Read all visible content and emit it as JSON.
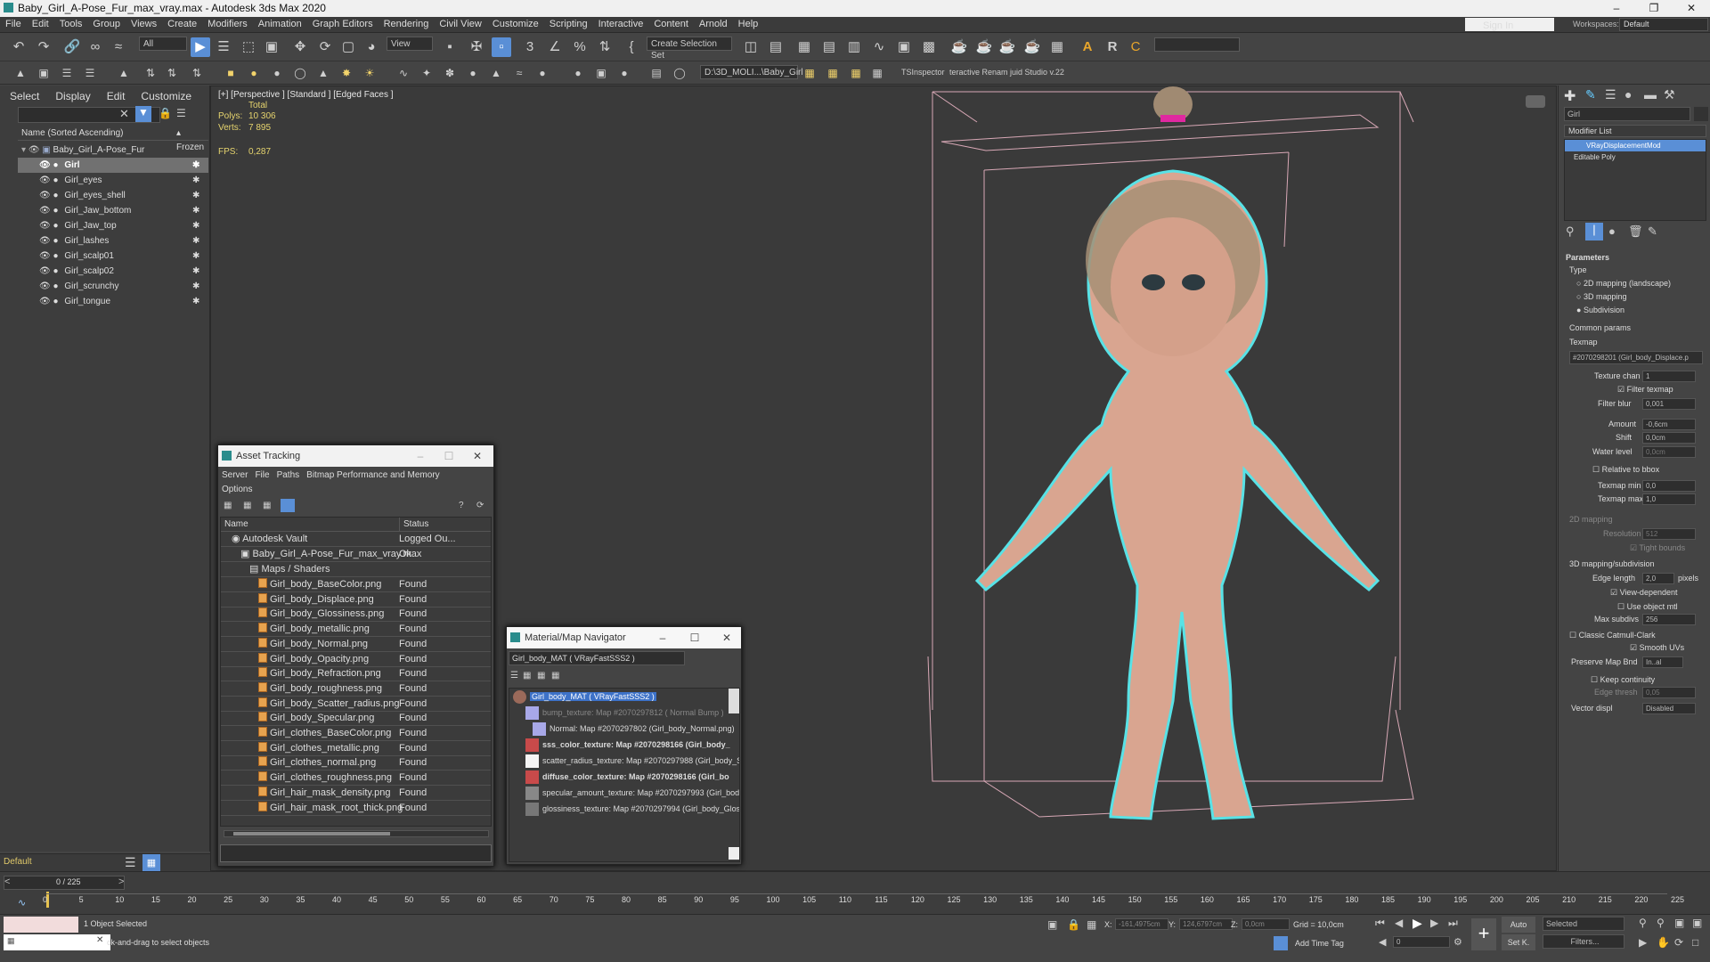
{
  "window": {
    "title": "Baby_Girl_A-Pose_Fur_max_vray.max - Autodesk 3ds Max 2020"
  },
  "menu": [
    "File",
    "Edit",
    "Tools",
    "Group",
    "Views",
    "Create",
    "Modifiers",
    "Animation",
    "Graph Editors",
    "Rendering",
    "Civil View",
    "Customize",
    "Scripting",
    "Interactive",
    "Content",
    "Arnold",
    "Help"
  ],
  "signin": "Sign In",
  "workspaces": {
    "label": "Workspaces:",
    "value": "Default"
  },
  "toolbar": {
    "filter": "All",
    "refcoord": "View",
    "selection_set": "Create Selection Set",
    "path": "D:\\3D_MOLI...\\Baby_Girl",
    "ts_inspector": "TSInspector",
    "renamer": "teractive Renam juid Studio v.22"
  },
  "scene_explorer": {
    "tabs": [
      "Select",
      "Display",
      "Edit",
      "Customize"
    ],
    "header_name": "Name (Sorted Ascending)",
    "header_frozen": "▴ Frozen",
    "root": "Baby_Girl_A-Pose_Fur",
    "items": [
      "Girl",
      "Girl_eyes",
      "Girl_eyes_shell",
      "Girl_Jaw_bottom",
      "Girl_Jaw_top",
      "Girl_lashes",
      "Girl_scalp01",
      "Girl_scalp02",
      "Girl_scrunchy",
      "Girl_tongue"
    ],
    "layer": "Default"
  },
  "viewport": {
    "label": "[+] [Perspective ] [Standard ] [Edged Faces ]",
    "total": "Total",
    "polys_label": "Polys:",
    "polys": "10 306",
    "verts_label": "Verts:",
    "verts": "7 895",
    "fps_label": "FPS:",
    "fps": "0,287"
  },
  "asset_tracking": {
    "title": "Asset Tracking",
    "menu": [
      "Server",
      "File",
      "Paths",
      "Bitmap Performance and Memory"
    ],
    "menu2": "Options",
    "col_name": "Name",
    "col_status": "Status",
    "vault": "Autodesk Vault",
    "vault_status": "Logged Ou...",
    "file": "Baby_Girl_A-Pose_Fur_max_vray.max",
    "file_status": "Ok",
    "group": "Maps / Shaders",
    "maps": [
      "Girl_body_BaseColor.png",
      "Girl_body_Displace.png",
      "Girl_body_Glossiness.png",
      "Girl_body_metallic.png",
      "Girl_body_Normal.png",
      "Girl_body_Opacity.png",
      "Girl_body_Refraction.png",
      "Girl_body_roughness.png",
      "Girl_body_Scatter_radius.png",
      "Girl_body_Specular.png",
      "Girl_clothes_BaseColor.png",
      "Girl_clothes_metallic.png",
      "Girl_clothes_normal.png",
      "Girl_clothes_roughness.png",
      "Girl_hair_mask_density.png",
      "Girl_hair_mask_root_thick.png"
    ],
    "status_found": "Found"
  },
  "mat_nav": {
    "title": "Material/Map Navigator",
    "field": "Girl_body_MAT  ( VRayFastSSS2 )",
    "root": "Girl_body_MAT  ( VRayFastSSS2 )",
    "rows": [
      "bump_texture: Map #2070297812  ( Normal Bump )",
      "Normal: Map #2070297802 (Girl_body_Normal.png)",
      "sss_color_texture: Map #2070298166 (Girl_body_",
      "scatter_radius_texture: Map #2070297988 (Girl_body_Sc",
      "diffuse_color_texture: Map #2070298166 (Girl_bo",
      "specular_amount_texture: Map #2070297993 (Girl_body",
      "glossiness_texture: Map #2070297994 (Girl_body_Glossi"
    ]
  },
  "command_panel": {
    "object_name": "Girl",
    "modifier_list": "Modifier List",
    "stack": [
      "VRayDisplacementMod",
      "Editable Poly"
    ],
    "parameters": "Parameters",
    "type_label": "Type",
    "types": [
      "2D mapping (landscape)",
      "3D mapping",
      "Subdivision"
    ],
    "common": "Common params",
    "texmap_label": "Texmap",
    "texmap": "#2070298201 (Girl_body_Displace.p",
    "texture_chan_label": "Texture chan",
    "texture_chan": "1",
    "filter_texmap": "Filter texmap",
    "filter_blur_label": "Filter blur",
    "filter_blur": "0,001",
    "amount_label": "Amount",
    "amount": "-0,6cm",
    "shift_label": "Shift",
    "shift": "0,0cm",
    "water_label": "Water level",
    "water": "0,0cm",
    "relative_bbox": "Relative to bbox",
    "texmap_min_label": "Texmap min",
    "texmap_min": "0,0",
    "texmap_max_label": "Texmap max",
    "texmap_max": "1,0",
    "mapping2d": "2D mapping",
    "resolution_label": "Resolution",
    "resolution": "512",
    "tight_bounds": "Tight bounds",
    "mapping3d": "3D mapping/subdivision",
    "edge_length_label": "Edge length",
    "edge_length": "2,0",
    "pixels": "pixels",
    "view_dependent": "View-dependent",
    "use_object_mtl": "Use object mtl",
    "max_subdivs_label": "Max subdivs",
    "max_subdivs": "256",
    "classic_cc": "Classic Catmull-Clark",
    "smooth_uvs": "Smooth UVs",
    "preserve_label": "Preserve Map Bnd",
    "preserve": "In..al",
    "keep_cont": "Keep continuity",
    "edge_thresh_label": "Edge thresh",
    "edge_thresh": "0,05",
    "vector_label": "Vector displ",
    "vector": "Disabled"
  },
  "timeline": {
    "frame": "0 / 225",
    "ticks": [
      "0",
      "5",
      "10",
      "15",
      "20",
      "25",
      "30",
      "35",
      "40",
      "45",
      "50",
      "55",
      "60",
      "65",
      "70",
      "75",
      "80",
      "85",
      "90",
      "95",
      "100",
      "105",
      "110",
      "115",
      "120",
      "125",
      "130",
      "135",
      "140",
      "145",
      "150",
      "155",
      "160",
      "165",
      "170",
      "175",
      "180",
      "185",
      "190",
      "195",
      "200",
      "205",
      "210",
      "215",
      "220",
      "225"
    ]
  },
  "status": {
    "selected": "1 Object Selected",
    "hint": "ck-and-drag to select objects",
    "x_label": "X:",
    "x": "-161,4975cm",
    "y_label": "Y:",
    "y": "124,6797cm",
    "z_label": "Z:",
    "z": "0,0cm",
    "grid": "Grid = 10,0cm",
    "add_time_tag": "Add Time Tag",
    "auto": "Auto",
    "selected_dd": "Selected",
    "setk": "Set K.",
    "filters": "Filters...",
    "frame_num": "0"
  }
}
